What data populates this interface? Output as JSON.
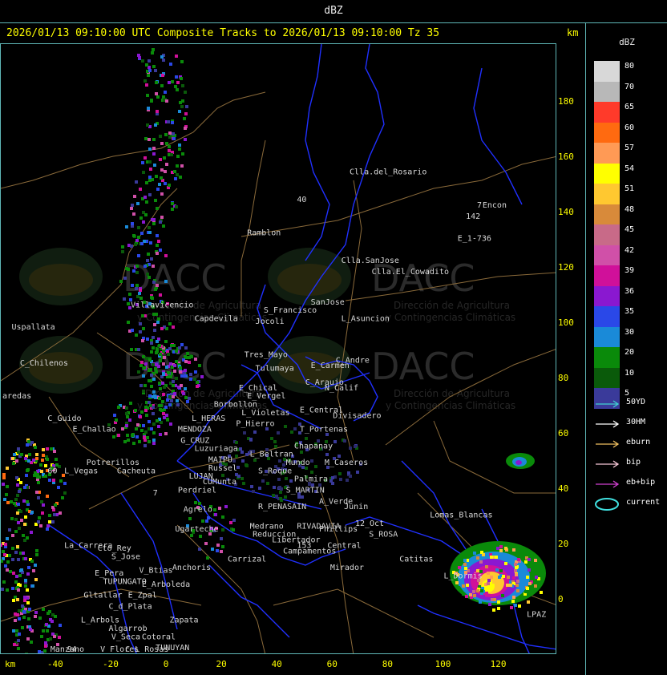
{
  "window": {
    "title": "dBZ"
  },
  "header": {
    "text": "2026/01/13 09:10:00 UTC Composite Tracks to 2026/01/13 09:10:00 Tz 35",
    "km_label": "km"
  },
  "axes": {
    "km_label": "km",
    "y_ticks": [
      180,
      160,
      140,
      120,
      100,
      80,
      60,
      40,
      20,
      0
    ],
    "x_ticks": [
      -40,
      -20,
      0,
      20,
      40,
      60,
      80,
      100,
      120
    ],
    "x_range": [
      -60,
      140
    ],
    "y_range": [
      -20,
      200
    ]
  },
  "legend": {
    "title": "dBZ",
    "scale": [
      {
        "label": "80",
        "color": "#d8d8d8"
      },
      {
        "label": "70",
        "color": "#b8b8b8"
      },
      {
        "label": "65",
        "color": "#ff3a2a"
      },
      {
        "label": "60",
        "color": "#ff6a10"
      },
      {
        "label": "57",
        "color": "#ff9a55"
      },
      {
        "label": "54",
        "color": "#ffff00"
      },
      {
        "label": "51",
        "color": "#ffc830"
      },
      {
        "label": "48",
        "color": "#d88a3a"
      },
      {
        "label": "45",
        "color": "#c86a88"
      },
      {
        "label": "42",
        "color": "#d050a8"
      },
      {
        "label": "39",
        "color": "#d0109a"
      },
      {
        "label": "36",
        "color": "#8a18d0"
      },
      {
        "label": "35",
        "color": "#2a48e8"
      },
      {
        "label": "30",
        "color": "#1a8ad8"
      },
      {
        "label": "20",
        "color": "#0a8a0a"
      },
      {
        "label": "10",
        "color": "#0a5a0a"
      },
      {
        "label": "5",
        "color": "#3a3a9a"
      }
    ],
    "tracks": [
      {
        "label": "50YD",
        "color": "#40d0d0",
        "kind": "arrow"
      },
      {
        "label": "30HM",
        "color": "#ffffff",
        "kind": "arrow"
      },
      {
        "label": "eburn",
        "color": "#f0c060",
        "kind": "arrow"
      },
      {
        "label": "bip",
        "color": "#f8c8d8",
        "kind": "arrow"
      },
      {
        "label": "eb+bip",
        "color": "#d040d0",
        "kind": "arrow"
      },
      {
        "label": "current",
        "color": "#40e0e0",
        "kind": "ellipse"
      }
    ]
  },
  "watermark": {
    "brand": "DACC",
    "line1": "Dirección de Agricultura",
    "line2": "y Contingencias Climáticas"
  },
  "places": [
    {
      "name": "Clla.del_Rosario",
      "x": 66,
      "y": 154
    },
    {
      "name": "Encon",
      "x": 114,
      "y": 142
    },
    {
      "name": "142",
      "x": 108,
      "y": 138
    },
    {
      "name": "E_1-736",
      "x": 105,
      "y": 130
    },
    {
      "name": "Ramblon",
      "x": 29,
      "y": 132
    },
    {
      "name": "Clla.SanJose",
      "x": 63,
      "y": 122
    },
    {
      "name": "Clla.El_Cowadito",
      "x": 74,
      "y": 118
    },
    {
      "name": "Villavicencio",
      "x": -13,
      "y": 106
    },
    {
      "name": "Capdevila",
      "x": 10,
      "y": 101
    },
    {
      "name": "S_Francisco",
      "x": 35,
      "y": 104
    },
    {
      "name": "SanJose",
      "x": 52,
      "y": 107
    },
    {
      "name": "Jocoli",
      "x": 32,
      "y": 100
    },
    {
      "name": "L_Asuncion",
      "x": 63,
      "y": 101
    },
    {
      "name": "Uspallata",
      "x": -56,
      "y": 98
    },
    {
      "name": "Tres_Mayo",
      "x": 28,
      "y": 88
    },
    {
      "name": "C_Andre",
      "x": 61,
      "y": 86
    },
    {
      "name": "Tulumaya",
      "x": 32,
      "y": 83
    },
    {
      "name": "E_Carmen",
      "x": 52,
      "y": 84
    },
    {
      "name": "C_Chilenos",
      "x": -53,
      "y": 85
    },
    {
      "name": "C_Araujo",
      "x": 50,
      "y": 78
    },
    {
      "name": "N_Calif",
      "x": 57,
      "y": 76
    },
    {
      "name": "E_Chical",
      "x": 26,
      "y": 76
    },
    {
      "name": "E_Vergel",
      "x": 29,
      "y": 73
    },
    {
      "name": "aredas",
      "x": -60,
      "y": 73
    },
    {
      "name": "Borbollon",
      "x": 17,
      "y": 70
    },
    {
      "name": "L_Violetas",
      "x": 27,
      "y": 67
    },
    {
      "name": "E_Central",
      "x": 48,
      "y": 68
    },
    {
      "name": "Divisadero",
      "x": 60,
      "y": 66
    },
    {
      "name": "L_HERAS",
      "x": 9,
      "y": 65
    },
    {
      "name": "P_Hierro",
      "x": 25,
      "y": 63
    },
    {
      "name": "C_Guido",
      "x": -43,
      "y": 65
    },
    {
      "name": "E_Challao",
      "x": -34,
      "y": 61
    },
    {
      "name": "MENDOZA",
      "x": 4,
      "y": 61
    },
    {
      "name": "T_Portenas",
      "x": 48,
      "y": 61
    },
    {
      "name": "G_CRUZ",
      "x": 5,
      "y": 57
    },
    {
      "name": "Chapanay",
      "x": 46,
      "y": 55
    },
    {
      "name": "Luzuriaga",
      "x": 10,
      "y": 54
    },
    {
      "name": "L_Beltran",
      "x": 30,
      "y": 52
    },
    {
      "name": "Mundo",
      "x": 43,
      "y": 49
    },
    {
      "name": "M_Caseros",
      "x": 57,
      "y": 49
    },
    {
      "name": "Potrerillos",
      "x": -29,
      "y": 49
    },
    {
      "name": "MAIPU",
      "x": 15,
      "y": 50
    },
    {
      "name": "Russel",
      "x": 15,
      "y": 47
    },
    {
      "name": "S_Roque",
      "x": 33,
      "y": 46
    },
    {
      "name": "L_Vegas",
      "x": -37,
      "y": 46
    },
    {
      "name": "Cacheuta",
      "x": -18,
      "y": 46
    },
    {
      "name": "LUJAN",
      "x": 8,
      "y": 44
    },
    {
      "name": "CUMunta",
      "x": 13,
      "y": 42
    },
    {
      "name": "Palmira",
      "x": 46,
      "y": 43
    },
    {
      "name": "S_MARTIN",
      "x": 43,
      "y": 39
    },
    {
      "name": "Perdriel",
      "x": 4,
      "y": 39
    },
    {
      "name": "A_Verde",
      "x": 55,
      "y": 35
    },
    {
      "name": "R_PENASAIN",
      "x": 33,
      "y": 33
    },
    {
      "name": "Junin",
      "x": 64,
      "y": 33
    },
    {
      "name": "Agrelo",
      "x": 6,
      "y": 32
    },
    {
      "name": "Ugarteche",
      "x": 3,
      "y": 25
    },
    {
      "name": "Medrano",
      "x": 30,
      "y": 26
    },
    {
      "name": "RIVADAVIA",
      "x": 47,
      "y": 26
    },
    {
      "name": "Phillips",
      "x": 55,
      "y": 25
    },
    {
      "name": "12_Oct",
      "x": 68,
      "y": 27
    },
    {
      "name": "Lomas_Blancas",
      "x": 95,
      "y": 30
    },
    {
      "name": "Reduccion",
      "x": 31,
      "y": 23
    },
    {
      "name": "Libertador",
      "x": 38,
      "y": 21
    },
    {
      "name": "S_ROSA",
      "x": 73,
      "y": 23
    },
    {
      "name": "La_Carrera",
      "x": -37,
      "y": 19
    },
    {
      "name": "Cto_Rey",
      "x": -25,
      "y": 18
    },
    {
      "name": "Central",
      "x": 58,
      "y": 19
    },
    {
      "name": "Campamentos",
      "x": 42,
      "y": 17
    },
    {
      "name": "S_Jose",
      "x": -20,
      "y": 15
    },
    {
      "name": "Carrizal",
      "x": 22,
      "y": 14
    },
    {
      "name": "Catitas",
      "x": 84,
      "y": 14
    },
    {
      "name": "Anchoris",
      "x": 2,
      "y": 11
    },
    {
      "name": "V_Btias",
      "x": -10,
      "y": 10
    },
    {
      "name": "Mirador",
      "x": 59,
      "y": 11
    },
    {
      "name": "E_Pera",
      "x": -26,
      "y": 9
    },
    {
      "name": "TUPUNGATO",
      "x": -23,
      "y": 6
    },
    {
      "name": "L_Dormis",
      "x": 100,
      "y": 8
    },
    {
      "name": "E_Arboleda",
      "x": -9,
      "y": 5
    },
    {
      "name": "Gltallar",
      "x": -30,
      "y": 1
    },
    {
      "name": "E_Zpal",
      "x": -14,
      "y": 1
    },
    {
      "name": "C_d_Plata",
      "x": -21,
      "y": -3
    },
    {
      "name": "L_Arbols",
      "x": -31,
      "y": -8
    },
    {
      "name": "Zapata",
      "x": 1,
      "y": -8
    },
    {
      "name": "LPAZ",
      "x": 130,
      "y": -6
    },
    {
      "name": "Algarrob",
      "x": -21,
      "y": -11
    },
    {
      "name": "V_Seca",
      "x": -20,
      "y": -14
    },
    {
      "name": "Cotoral",
      "x": -9,
      "y": -14
    },
    {
      "name": "Manzano",
      "x": -42,
      "y": -19
    },
    {
      "name": "C_L_Rosas",
      "x": -15,
      "y": -21
    },
    {
      "name": "TUNUYAN",
      "x": -4,
      "y": -18
    },
    {
      "name": "V_Flores",
      "x": -24,
      "y": -27
    },
    {
      "name": "40",
      "x": 47,
      "y": 144
    },
    {
      "name": "7",
      "x": 112,
      "y": 142
    },
    {
      "name": "60",
      "x": -43,
      "y": 46
    },
    {
      "name": "7",
      "x": -5,
      "y": 38
    },
    {
      "name": "153",
      "x": 47,
      "y": 19
    },
    {
      "name": "94",
      "x": -36,
      "y": -20
    }
  ]
}
